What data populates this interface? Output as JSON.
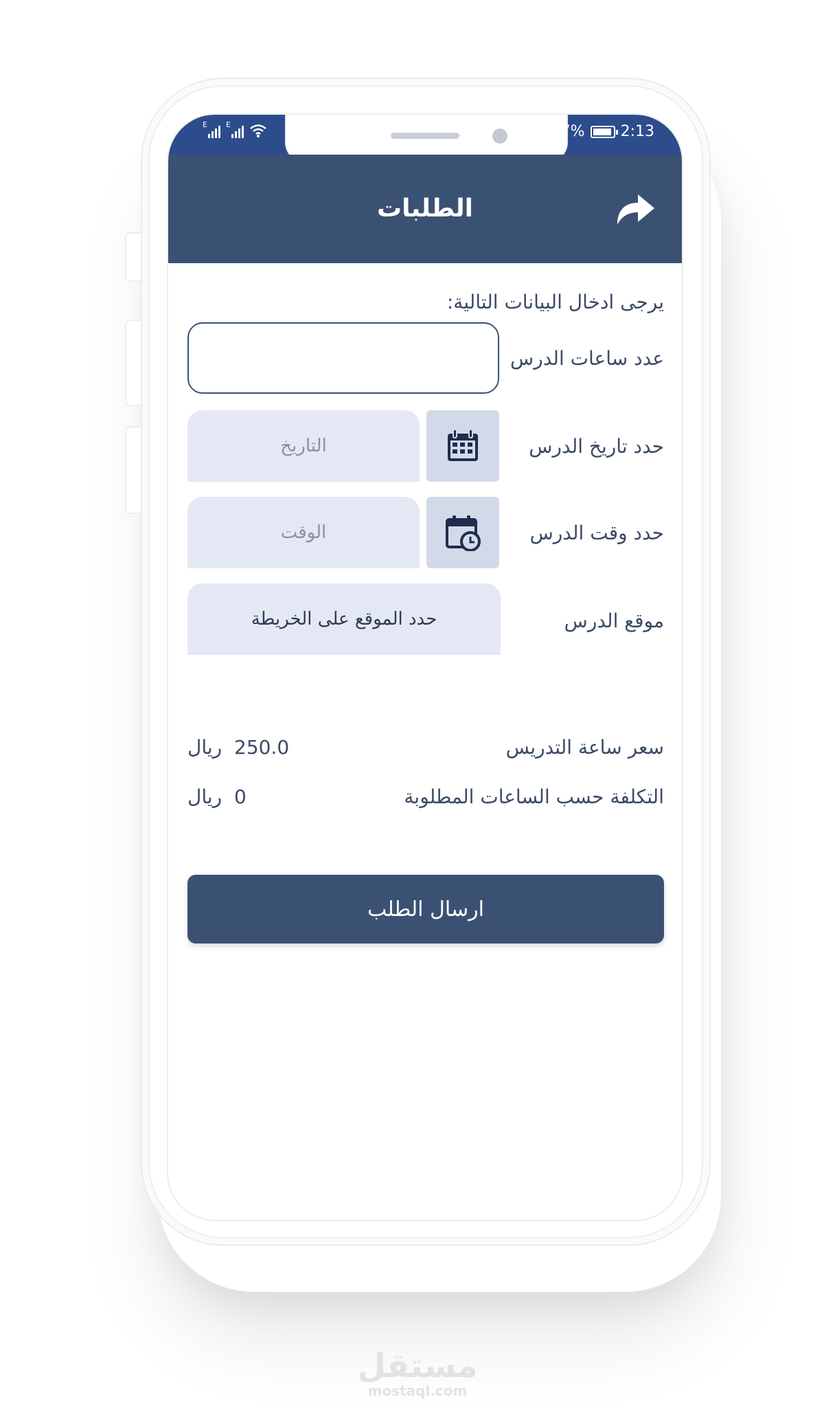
{
  "status_bar": {
    "battery_percent": "7%",
    "time": "2:13",
    "signal_label": "E",
    "bg_color": "#2c4c8c"
  },
  "header": {
    "title": "الطلبات",
    "share_icon": "share-arrow-icon",
    "bg_color": "#3b5174"
  },
  "form": {
    "intro": "يرجى ادخال البيانات التالية:",
    "hours_label": "عدد ساعات الدرس",
    "hours_value": "",
    "date_label": "حدد تاريخ الدرس",
    "date_placeholder": "التاريخ",
    "date_icon": "calendar-icon",
    "time_label": "حدد وقت الدرس",
    "time_placeholder": "الوقت",
    "time_icon": "calendar-clock-icon",
    "location_label": "موقع الدرس",
    "location_button": "حدد الموقع على الخريطة"
  },
  "pricing": {
    "hour_price_label": "سعر ساعة التدريس",
    "hour_price_value": "250.0",
    "hour_price_unit": "ريال",
    "total_label": "التكلفة حسب الساعات المطلوبة",
    "total_value": "0",
    "total_unit": "ريال"
  },
  "submit": {
    "label": "ارسال الطلب"
  },
  "watermark": {
    "arabic": "مستقل",
    "latin": "mostaql.com"
  }
}
